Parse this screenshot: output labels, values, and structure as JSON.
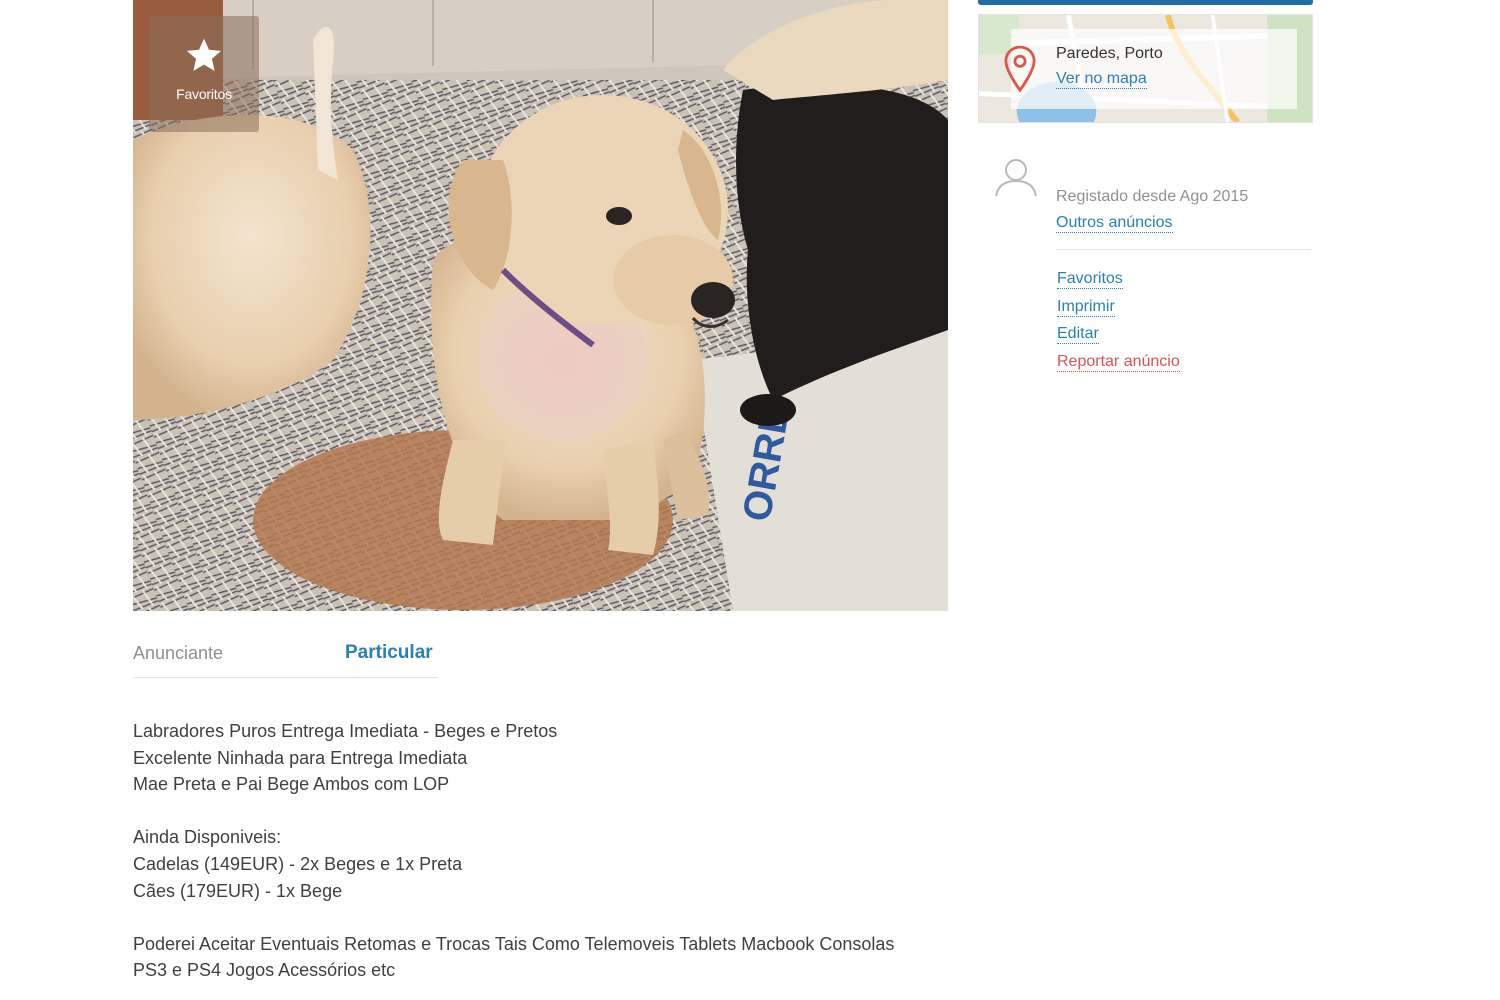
{
  "photo": {
    "favorites_label": "Favoritos",
    "star_icon": "star-icon",
    "newspaper_text": "ORRE"
  },
  "advertiser": {
    "label": "Anunciante",
    "value": "Particular"
  },
  "description": {
    "lines": [
      "Labradores Puros Entrega Imediata - Beges e Pretos",
      "Excelente Ninhada para Entrega Imediata",
      "Mae Preta e Pai Bege Ambos com LOP",
      "",
      "Ainda Disponiveis:",
      "Cadelas (149EUR) - 2x Beges e 1x Preta",
      "Cães (179EUR) - 1x Bege",
      "",
      "Poderei Aceitar Eventuais Retomas e Trocas Tais Como Telemoveis Tablets Macbook Consolas",
      "PS3 e PS4 Jogos Acessórios etc"
    ]
  },
  "map": {
    "location": "Paredes, Porto",
    "view_map_link": "Ver no mapa",
    "pin_icon": "map-pin-icon"
  },
  "user": {
    "avatar_icon": "user-avatar-icon",
    "registered": "Registado desde Ago 2015",
    "other_ads_link": "Outros anúncios"
  },
  "actions": {
    "favorites": "Favoritos",
    "print": "Imprimir",
    "edit": "Editar",
    "report": "Reportar anúncio"
  },
  "colors": {
    "link": "#2a7fb5",
    "report": "#d9534f",
    "accent_bar": "#1f6ea3",
    "muted": "#8f8f8f"
  }
}
